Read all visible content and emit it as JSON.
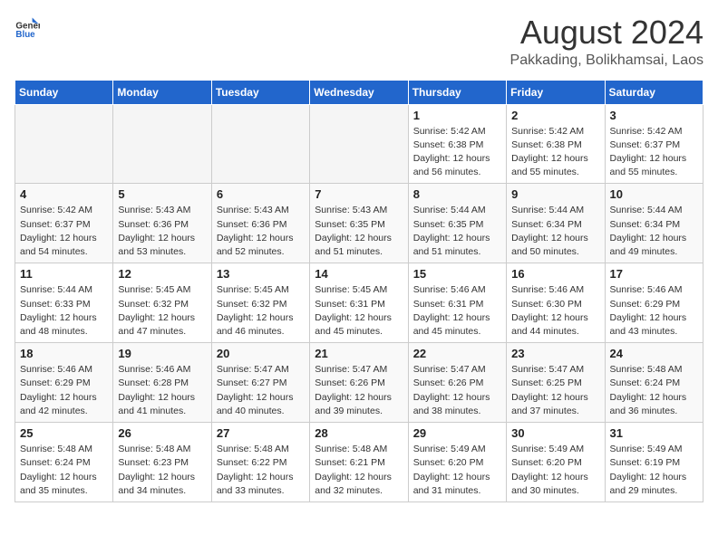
{
  "logo": {
    "text_general": "General",
    "text_blue": "Blue"
  },
  "title": "August 2024",
  "subtitle": "Pakkading, Bolikhamsai, Laos",
  "days_of_week": [
    "Sunday",
    "Monday",
    "Tuesday",
    "Wednesday",
    "Thursday",
    "Friday",
    "Saturday"
  ],
  "weeks": [
    [
      {
        "day": "",
        "sunrise": "",
        "sunset": "",
        "daylight": ""
      },
      {
        "day": "",
        "sunrise": "",
        "sunset": "",
        "daylight": ""
      },
      {
        "day": "",
        "sunrise": "",
        "sunset": "",
        "daylight": ""
      },
      {
        "day": "",
        "sunrise": "",
        "sunset": "",
        "daylight": ""
      },
      {
        "day": "1",
        "sunrise": "5:42 AM",
        "sunset": "6:38 PM",
        "daylight": "12 hours and 56 minutes."
      },
      {
        "day": "2",
        "sunrise": "5:42 AM",
        "sunset": "6:38 PM",
        "daylight": "12 hours and 55 minutes."
      },
      {
        "day": "3",
        "sunrise": "5:42 AM",
        "sunset": "6:37 PM",
        "daylight": "12 hours and 55 minutes."
      }
    ],
    [
      {
        "day": "4",
        "sunrise": "5:42 AM",
        "sunset": "6:37 PM",
        "daylight": "12 hours and 54 minutes."
      },
      {
        "day": "5",
        "sunrise": "5:43 AM",
        "sunset": "6:36 PM",
        "daylight": "12 hours and 53 minutes."
      },
      {
        "day": "6",
        "sunrise": "5:43 AM",
        "sunset": "6:36 PM",
        "daylight": "12 hours and 52 minutes."
      },
      {
        "day": "7",
        "sunrise": "5:43 AM",
        "sunset": "6:35 PM",
        "daylight": "12 hours and 51 minutes."
      },
      {
        "day": "8",
        "sunrise": "5:44 AM",
        "sunset": "6:35 PM",
        "daylight": "12 hours and 51 minutes."
      },
      {
        "day": "9",
        "sunrise": "5:44 AM",
        "sunset": "6:34 PM",
        "daylight": "12 hours and 50 minutes."
      },
      {
        "day": "10",
        "sunrise": "5:44 AM",
        "sunset": "6:34 PM",
        "daylight": "12 hours and 49 minutes."
      }
    ],
    [
      {
        "day": "11",
        "sunrise": "5:44 AM",
        "sunset": "6:33 PM",
        "daylight": "12 hours and 48 minutes."
      },
      {
        "day": "12",
        "sunrise": "5:45 AM",
        "sunset": "6:32 PM",
        "daylight": "12 hours and 47 minutes."
      },
      {
        "day": "13",
        "sunrise": "5:45 AM",
        "sunset": "6:32 PM",
        "daylight": "12 hours and 46 minutes."
      },
      {
        "day": "14",
        "sunrise": "5:45 AM",
        "sunset": "6:31 PM",
        "daylight": "12 hours and 45 minutes."
      },
      {
        "day": "15",
        "sunrise": "5:46 AM",
        "sunset": "6:31 PM",
        "daylight": "12 hours and 45 minutes."
      },
      {
        "day": "16",
        "sunrise": "5:46 AM",
        "sunset": "6:30 PM",
        "daylight": "12 hours and 44 minutes."
      },
      {
        "day": "17",
        "sunrise": "5:46 AM",
        "sunset": "6:29 PM",
        "daylight": "12 hours and 43 minutes."
      }
    ],
    [
      {
        "day": "18",
        "sunrise": "5:46 AM",
        "sunset": "6:29 PM",
        "daylight": "12 hours and 42 minutes."
      },
      {
        "day": "19",
        "sunrise": "5:46 AM",
        "sunset": "6:28 PM",
        "daylight": "12 hours and 41 minutes."
      },
      {
        "day": "20",
        "sunrise": "5:47 AM",
        "sunset": "6:27 PM",
        "daylight": "12 hours and 40 minutes."
      },
      {
        "day": "21",
        "sunrise": "5:47 AM",
        "sunset": "6:26 PM",
        "daylight": "12 hours and 39 minutes."
      },
      {
        "day": "22",
        "sunrise": "5:47 AM",
        "sunset": "6:26 PM",
        "daylight": "12 hours and 38 minutes."
      },
      {
        "day": "23",
        "sunrise": "5:47 AM",
        "sunset": "6:25 PM",
        "daylight": "12 hours and 37 minutes."
      },
      {
        "day": "24",
        "sunrise": "5:48 AM",
        "sunset": "6:24 PM",
        "daylight": "12 hours and 36 minutes."
      }
    ],
    [
      {
        "day": "25",
        "sunrise": "5:48 AM",
        "sunset": "6:24 PM",
        "daylight": "12 hours and 35 minutes."
      },
      {
        "day": "26",
        "sunrise": "5:48 AM",
        "sunset": "6:23 PM",
        "daylight": "12 hours and 34 minutes."
      },
      {
        "day": "27",
        "sunrise": "5:48 AM",
        "sunset": "6:22 PM",
        "daylight": "12 hours and 33 minutes."
      },
      {
        "day": "28",
        "sunrise": "5:48 AM",
        "sunset": "6:21 PM",
        "daylight": "12 hours and 32 minutes."
      },
      {
        "day": "29",
        "sunrise": "5:49 AM",
        "sunset": "6:20 PM",
        "daylight": "12 hours and 31 minutes."
      },
      {
        "day": "30",
        "sunrise": "5:49 AM",
        "sunset": "6:20 PM",
        "daylight": "12 hours and 30 minutes."
      },
      {
        "day": "31",
        "sunrise": "5:49 AM",
        "sunset": "6:19 PM",
        "daylight": "12 hours and 29 minutes."
      }
    ]
  ]
}
